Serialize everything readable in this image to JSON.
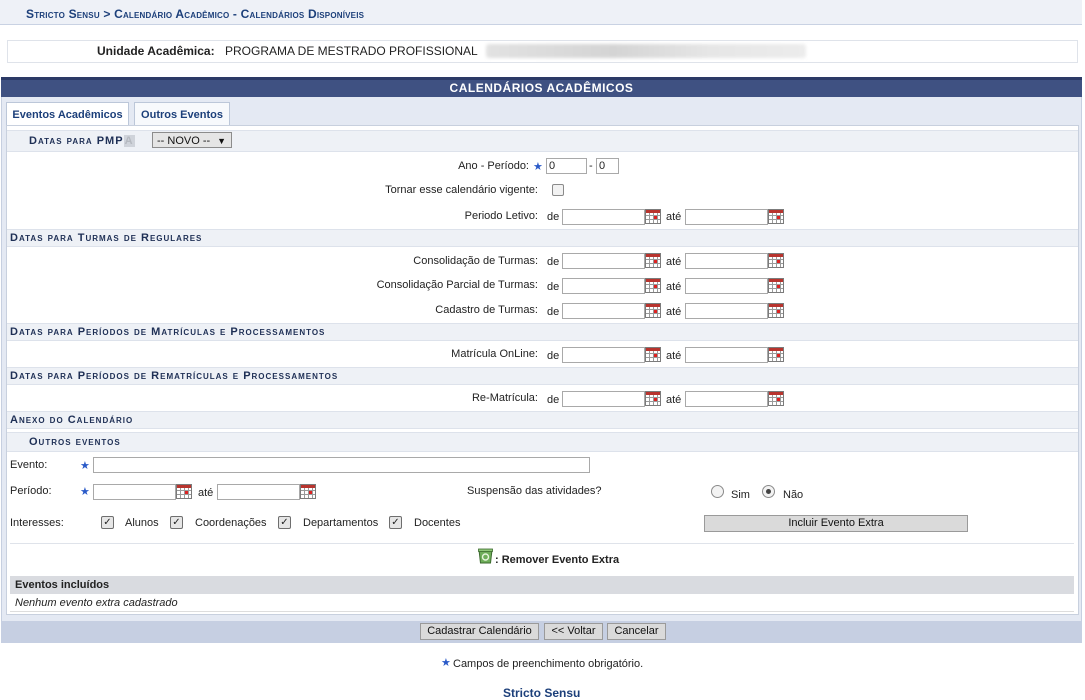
{
  "breadcrumb": "Stricto Sensu > Calendário Acadêmico - Calendários Disponíveis",
  "unit": {
    "label": "Unidade Acadêmica:",
    "value": "PROGRAMA DE MESTRADO PROFISSIONAL"
  },
  "main_title": "CALENDÁRIOS ACADÊMICOS",
  "tabs": [
    "Eventos Acadêmicos",
    "Outros Eventos"
  ],
  "datas_para": {
    "label": "Datas para PMP",
    "obscured": "A",
    "select_value": "-- NOVO --"
  },
  "form": {
    "ano_periodo_label": "Ano - Período:",
    "ano_value": "0",
    "periodo_value": "0",
    "separator": "-",
    "vigente_label": "Tornar esse calendário vigente:",
    "periodo_letivo_label": "Periodo Letivo:",
    "de": "de",
    "ate": "até"
  },
  "sections": {
    "turmas": "Datas para Turmas de Regulares",
    "matriculas": "Datas para Períodos de Matrículas e Processamentos",
    "rematriculas": "Datas para Períodos de Rematrículas e Processamentos",
    "anexo": "Anexo do Calendário",
    "outros": "Outros eventos"
  },
  "turmas_rows": [
    "Consolidação de Turmas:",
    "Consolidação Parcial de Turmas:",
    "Cadastro de Turmas:"
  ],
  "matricula_label": "Matrícula OnLine:",
  "rematricula_label": "Re-Matrícula:",
  "outros": {
    "evento_label": "Evento:",
    "periodo_label": "Período:",
    "ate": "até",
    "suspensao_label": "Suspensão das atividades?",
    "sim": "Sim",
    "nao": "Não",
    "interesses_label": "Interesses:",
    "interesses": [
      "Alunos",
      "Coordenações",
      "Departamentos",
      "Docentes"
    ],
    "incluir_button": "Incluir Evento Extra",
    "remover_label": ": Remover Evento Extra"
  },
  "eventos_incluidos": {
    "header": "Eventos incluídos",
    "empty": "Nenhum evento extra cadastrado"
  },
  "buttons": {
    "cadastrar": "Cadastrar Calendário",
    "voltar": "<< Voltar",
    "cancelar": "Cancelar"
  },
  "required_note": "Campos de preenchimento obrigatório.",
  "footer_link": "Stricto Sensu"
}
